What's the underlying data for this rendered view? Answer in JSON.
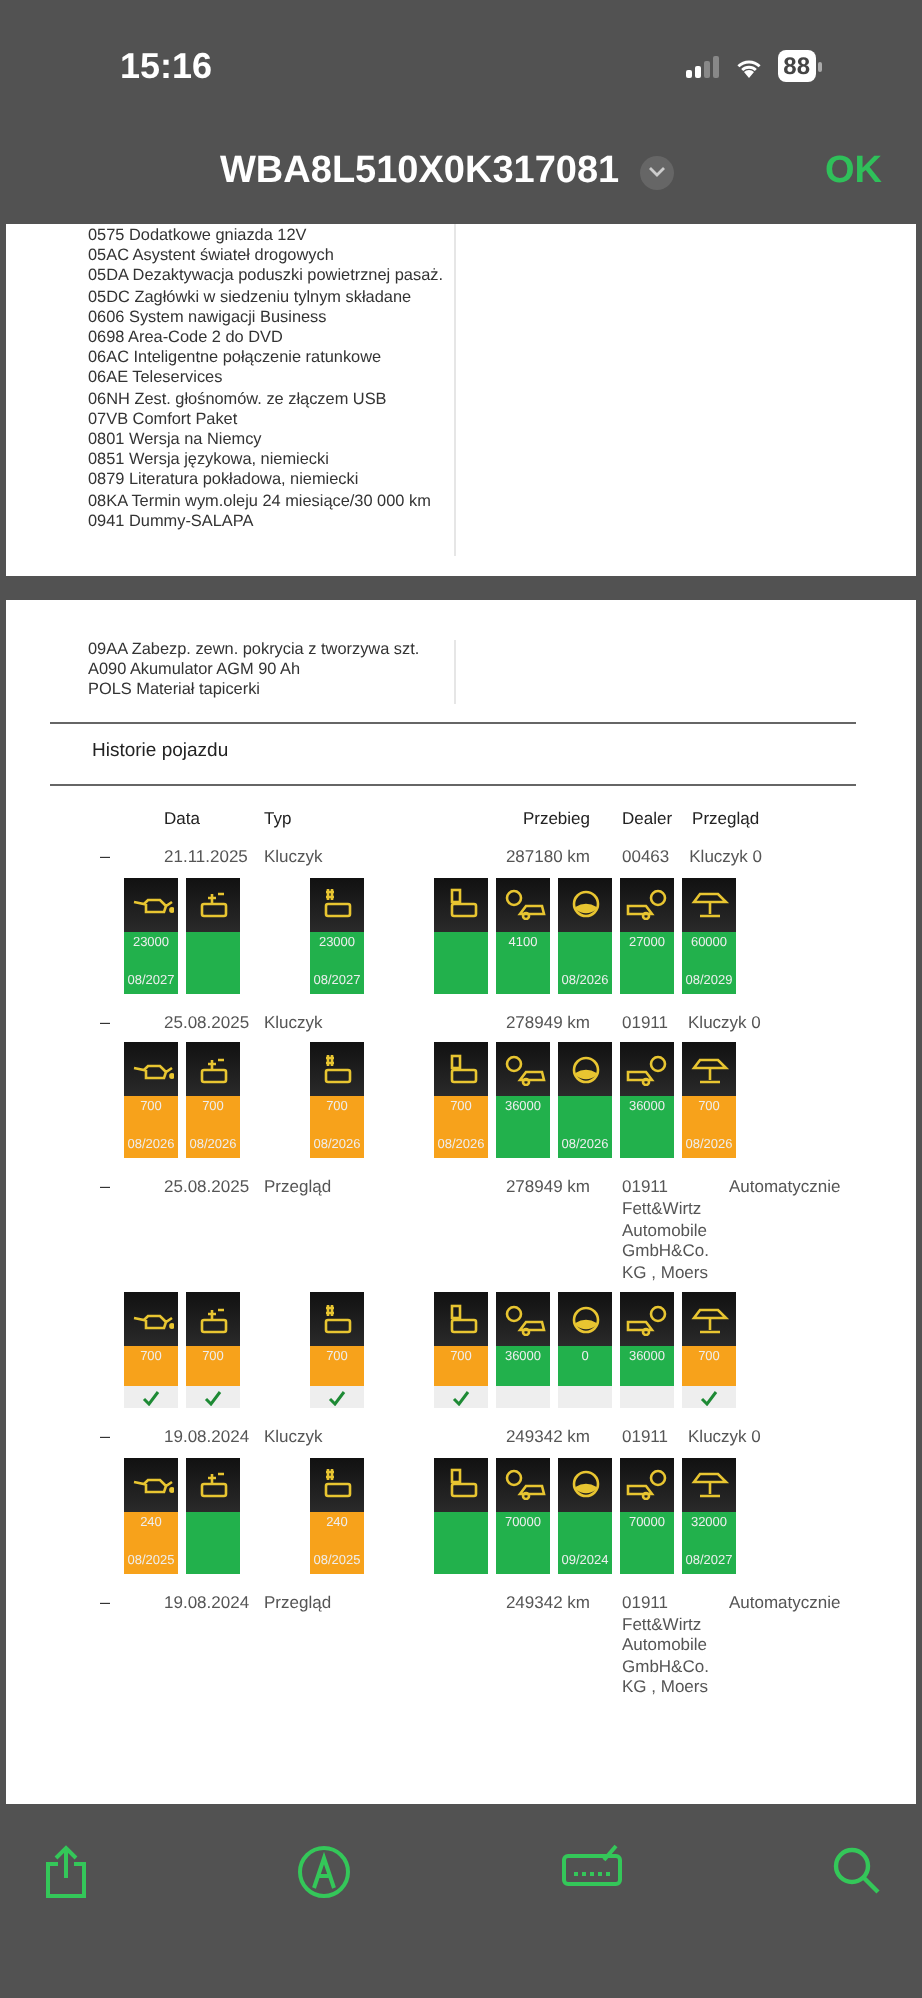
{
  "status_bar": {
    "time": "15:16",
    "battery": "88"
  },
  "nav": {
    "title": "WBA8L510X0K317081",
    "ok": "OK"
  },
  "page_1": {
    "options": [
      "0575 Dodatkowe gniazda 12V",
      "05AC Asystent świateł drogowych",
      "05DA Dezaktywacja poduszki powietrznej pasaż.",
      "05DC Zagłówki w siedzeniu tylnym składane",
      "0606 System nawigacji Business",
      "0698 Area-Code 2 do DVD",
      "06AC Inteligentne połączenie ratunkowe",
      "06AE Teleservices",
      "06NH Zest. głośnomów. ze złączem USB",
      "07VB Comfort Paket",
      "0801 Wersja na Niemcy",
      "0851 Wersja językowa, niemiecki",
      "0879 Literatura pokładowa, niemiecki",
      "08KA Termin wym.oleju 24 miesiące/30 000 km",
      "0941 Dummy-SALAPA"
    ]
  },
  "page_2": {
    "options": [
      "09AA Zabezp. zewn. pokrycia z tworzywa szt.",
      "A090 Akumulator AGM 90 Ah",
      "POLS Materiał tapicerki"
    ],
    "history": {
      "title": "Historie pojazdu",
      "columns": [
        "Data",
        "Typ",
        "Przebieg",
        "Dealer",
        "Przegląd"
      ],
      "entries": [
        {
          "toggle": "–",
          "date": "21.11.2025",
          "type": "Kluczyk",
          "mileage": "287180 km",
          "dealer": "00463",
          "review": "Kluczyk 0",
          "tiles": [
            {
              "kind": "oil",
              "color": "#22b14c",
              "value": "23000",
              "date": "08/2027"
            },
            {
              "kind": "engine-filter",
              "color": "#22b14c"
            },
            {
              "kind": "gap"
            },
            {
              "kind": "microfilter",
              "color": "#22b14c",
              "value": "23000",
              "date": "08/2027"
            },
            {
              "kind": "gap"
            },
            {
              "kind": "fuel-filter",
              "color": "#22b14c"
            },
            {
              "kind": "brake-front",
              "color": "#22b14c",
              "value": "4100"
            },
            {
              "kind": "brake-fluid",
              "color": "#22b14c",
              "date": "08/2026"
            },
            {
              "kind": "brake-rear",
              "color": "#22b14c",
              "value": "27000"
            },
            {
              "kind": "inspection",
              "color": "#22b14c",
              "value": "60000",
              "date": "08/2029"
            }
          ]
        },
        {
          "toggle": "–",
          "date": "25.08.2025",
          "type": "Kluczyk",
          "mileage": "278949 km",
          "dealer": "01911",
          "review": "Kluczyk 0",
          "tiles": [
            {
              "kind": "oil",
              "color": "#f7a21b",
              "value": "700",
              "date": "08/2026"
            },
            {
              "kind": "engine-filter",
              "color": "#f7a21b",
              "value": "700",
              "date": "08/2026"
            },
            {
              "kind": "gap"
            },
            {
              "kind": "microfilter",
              "color": "#f7a21b",
              "value": "700",
              "date": "08/2026"
            },
            {
              "kind": "gap"
            },
            {
              "kind": "fuel-filter",
              "color": "#f7a21b",
              "value": "700",
              "date": "08/2026"
            },
            {
              "kind": "brake-front",
              "color": "#22b14c",
              "value": "36000"
            },
            {
              "kind": "brake-fluid",
              "color": "#22b14c",
              "date": "08/2026"
            },
            {
              "kind": "brake-rear",
              "color": "#22b14c",
              "value": "36000"
            },
            {
              "kind": "inspection",
              "color": "#f7a21b",
              "value": "700",
              "date": "08/2026"
            }
          ]
        },
        {
          "toggle": "–",
          "date": "25.08.2025",
          "type": "Przegląd",
          "mileage": "278949 km",
          "dealer": "01911\nFett&Wirtz\nAutomobile\nGmbH&Co.\nKG , Moers",
          "review": "Automatycznie",
          "tiles": [
            {
              "kind": "oil",
              "color": "#f7a21b",
              "value": "700",
              "checked": true
            },
            {
              "kind": "engine-filter",
              "color": "#f7a21b",
              "value": "700",
              "checked": true
            },
            {
              "kind": "gap"
            },
            {
              "kind": "microfilter",
              "color": "#f7a21b",
              "value": "700",
              "checked": true
            },
            {
              "kind": "gap"
            },
            {
              "kind": "fuel-filter",
              "color": "#f7a21b",
              "value": "700",
              "checked": true
            },
            {
              "kind": "brake-front",
              "color": "#22b14c",
              "value": "36000",
              "checked": false
            },
            {
              "kind": "brake-fluid",
              "color": "#22b14c",
              "value": "0",
              "checked": false
            },
            {
              "kind": "brake-rear",
              "color": "#22b14c",
              "value": "36000",
              "checked": false
            },
            {
              "kind": "inspection",
              "color": "#f7a21b",
              "value": "700",
              "checked": true
            }
          ]
        },
        {
          "toggle": "–",
          "date": "19.08.2024",
          "type": "Kluczyk",
          "mileage": "249342 km",
          "dealer": "01911",
          "review": "Kluczyk 0",
          "tiles": [
            {
              "kind": "oil",
              "color": "#f7a21b",
              "value": "240",
              "date": "08/2025"
            },
            {
              "kind": "engine-filter",
              "color": "#22b14c"
            },
            {
              "kind": "gap"
            },
            {
              "kind": "microfilter",
              "color": "#f7a21b",
              "value": "240",
              "date": "08/2025"
            },
            {
              "kind": "gap"
            },
            {
              "kind": "fuel-filter",
              "color": "#22b14c"
            },
            {
              "kind": "brake-front",
              "color": "#22b14c",
              "value": "70000"
            },
            {
              "kind": "brake-fluid",
              "color": "#22b14c",
              "date": "09/2024"
            },
            {
              "kind": "brake-rear",
              "color": "#22b14c",
              "value": "70000"
            },
            {
              "kind": "inspection",
              "color": "#22b14c",
              "value": "32000",
              "date": "08/2027"
            }
          ]
        },
        {
          "toggle": "–",
          "date": "19.08.2024",
          "type": "Przegląd",
          "mileage": "249342 km",
          "dealer": "01911\nFett&Wirtz\nAutomobile\nGmbH&Co.\nKG , Moers",
          "review": "Automatycznie"
        }
      ]
    }
  }
}
